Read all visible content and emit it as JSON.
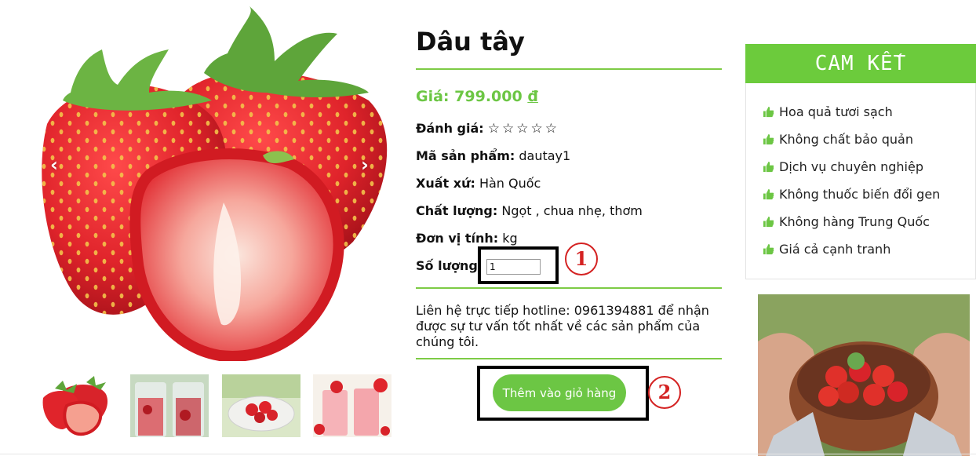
{
  "product": {
    "title": "Dâu tây",
    "price_label": "Giá:",
    "price_value": "799.000",
    "price_currency": "đ",
    "rating_label": "Đánh giá:",
    "rating_stars": "☆☆☆☆☆",
    "rating_value": 0,
    "sku_label": "Mã sản phẩm:",
    "sku_value": "dautay1",
    "origin_label": "Xuất xứ:",
    "origin_value": "Hàn Quốc",
    "quality_label": "Chất lượng:",
    "quality_value": "Ngọt , chua nhẹ, thơm",
    "unit_label": "Đơn vị tính:",
    "unit_value": "kg",
    "quantity_label": "Số lượng",
    "quantity_value": "1",
    "hotline_text": "Liên hệ trực tiếp hotline: 0961394881 để nhận được sự tư vấn tốt nhất về các sản phẩm của chúng tôi.",
    "add_to_cart_label": "Thêm vào giỏ hàng"
  },
  "gallery": {
    "prev_label": "‹",
    "next_label": "›",
    "thumbnails": [
      "strawberries",
      "strawberry-drink-cups",
      "strawberry-bowl",
      "strawberry-smoothie"
    ]
  },
  "annotations": {
    "marker_1": "1",
    "marker_2": "2"
  },
  "commitments": {
    "title": "CAM KẾT",
    "items": [
      "Hoa quả tươi sạch",
      "Không chất bảo quản",
      "Dịch vụ chuyên nghiệp",
      "Không thuốc biến đổi gen",
      "Không hàng Trung Quốc",
      "Giá cả cạnh tranh"
    ]
  },
  "colors": {
    "accent_green": "#6cc644",
    "annotation_red": "#d42222",
    "strawberry_red": "#e0242b"
  }
}
